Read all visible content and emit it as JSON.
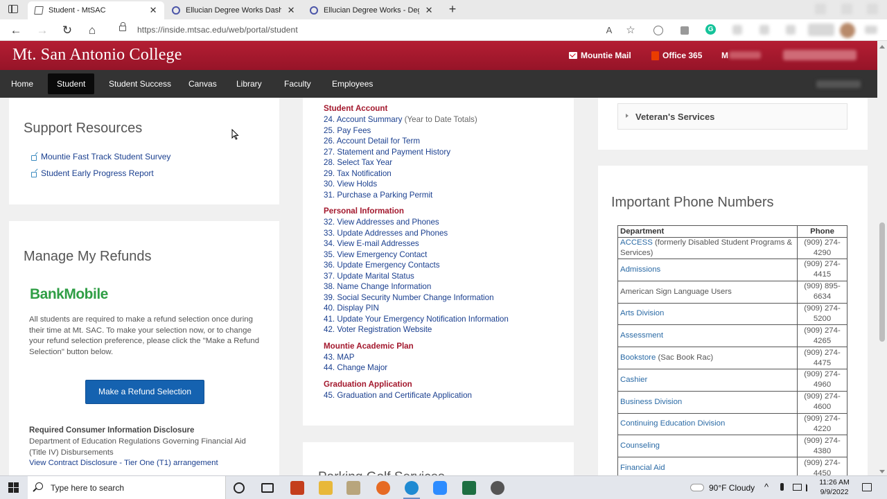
{
  "browser": {
    "tabs": [
      {
        "label": "Student - MtSAC",
        "active": true
      },
      {
        "label": "Ellucian Degree Works Dashboard",
        "active": false
      },
      {
        "label": "Ellucian Degree Works - Degree",
        "active": false
      }
    ],
    "close_glyph": "✕",
    "new_tab_glyph": "+",
    "url": "https://inside.mtsac.edu/web/portal/student",
    "back_glyph": "←",
    "forward_glyph": "→",
    "refresh_glyph": "↻",
    "home_glyph": "⌂",
    "read_aloud_glyph": "A",
    "favorite_glyph": "☆",
    "grammarly_glyph": "G"
  },
  "site": {
    "title": "Mt. San Antonio College",
    "header_links": {
      "mail": "Mountie Mail",
      "office": "Office 365",
      "my": "M"
    },
    "nav": [
      "Home",
      "Student",
      "Student Success",
      "Canvas",
      "Library",
      "Faculty",
      "Employees"
    ],
    "active_nav": "Student"
  },
  "support": {
    "title": "Support Resources",
    "links": [
      "Mountie Fast Track Student Survey",
      "Student Early Progress Report"
    ]
  },
  "refunds": {
    "title": "Manage My Refunds",
    "logo_text": "BankMobile",
    "paragraph": "All students are required to make a refund selection once during their time at Mt. SAC. To make your selection now, or to change your refund selection preference, please click the \"Make a Refund Selection\" button below.",
    "button": "Make a Refund Selection",
    "disclosure_head": "Required Consumer Information Disclosure",
    "disclosure_text": "Department of Education Regulations Governing Financial Aid (Title IV) Disbursements",
    "disclosure_link": "View Contract Disclosure - Tier One (T1) arrangement"
  },
  "account_sections": [
    {
      "heading": "Student Account",
      "items": [
        {
          "text": "24. Account Summary",
          "note": " (Year to Date Totals)"
        },
        {
          "text": "25. Pay Fees"
        },
        {
          "text": "26. Account Detail for Term"
        },
        {
          "text": "27. Statement and Payment History"
        },
        {
          "text": "28. Select Tax Year"
        },
        {
          "text": "29. Tax Notification"
        },
        {
          "text": "30. View Holds"
        },
        {
          "text": "31. Purchase a Parking Permit"
        }
      ]
    },
    {
      "heading": "Personal Information",
      "items": [
        {
          "text": "32. View Addresses and Phones"
        },
        {
          "text": "33. Update Addresses and Phones"
        },
        {
          "text": "34. View E-mail Addresses"
        },
        {
          "text": "35. View Emergency Contact"
        },
        {
          "text": "36. Update Emergency Contacts"
        },
        {
          "text": "37. Update Marital Status"
        },
        {
          "text": "38. Name Change Information"
        },
        {
          "text": "39. Social Security Number Change Information"
        },
        {
          "text": "40. Display PIN"
        },
        {
          "text": "41. Update Your Emergency Notification Information"
        },
        {
          "text": "42. Voter Registration Website"
        }
      ]
    },
    {
      "heading": "Mountie Academic Plan",
      "items": [
        {
          "text": "43. MAP"
        },
        {
          "text": "44. Change Major"
        }
      ]
    },
    {
      "heading": "Graduation Application",
      "items": [
        {
          "text": "45. Graduation and Certificate Application"
        }
      ]
    }
  ],
  "partial_title": "Parking Golf Services",
  "veterans": {
    "label": "Veteran's Services"
  },
  "phones": {
    "title": "Important Phone Numbers",
    "columns": [
      "Department",
      "Phone"
    ],
    "rows": [
      {
        "link": "ACCESS",
        "rest": " (formerly Disabled Student Programs & Services)",
        "phone": "(909) 274-4290"
      },
      {
        "link": "Admissions",
        "rest": "",
        "phone": "(909) 274-4415"
      },
      {
        "link": "",
        "rest": "American Sign Language Users",
        "phone": "(909) 895-6634"
      },
      {
        "link": "Arts Division",
        "rest": "",
        "phone": "(909) 274-5200"
      },
      {
        "link": "Assessment",
        "rest": "",
        "phone": "(909) 274-4265"
      },
      {
        "link": "Bookstore",
        "rest": " (Sac Book Rac)",
        "phone": "(909) 274-4475"
      },
      {
        "link": "Cashier",
        "rest": "",
        "phone": "(909) 274-4960"
      },
      {
        "link": "Business Division",
        "rest": "",
        "phone": "(909) 274-4600"
      },
      {
        "link": "Continuing Education Division",
        "rest": "",
        "phone": "(909) 274-4220"
      },
      {
        "link": "Counseling",
        "rest": "",
        "phone": "(909) 274-4380"
      },
      {
        "link": "Financial Aid",
        "rest": "",
        "phone": "(909) 274-4450"
      }
    ]
  },
  "taskbar": {
    "search_placeholder": "Type here to search",
    "weather": "90°F  Cloudy",
    "time": "11:26 AM",
    "date": "9/9/2022"
  },
  "colors": {
    "brand_red": "#a3182d",
    "nav_dark": "#333333",
    "link_blue": "#1a3f8f",
    "button_blue": "#1562b0",
    "bankmobile_green": "#2f9e45"
  }
}
